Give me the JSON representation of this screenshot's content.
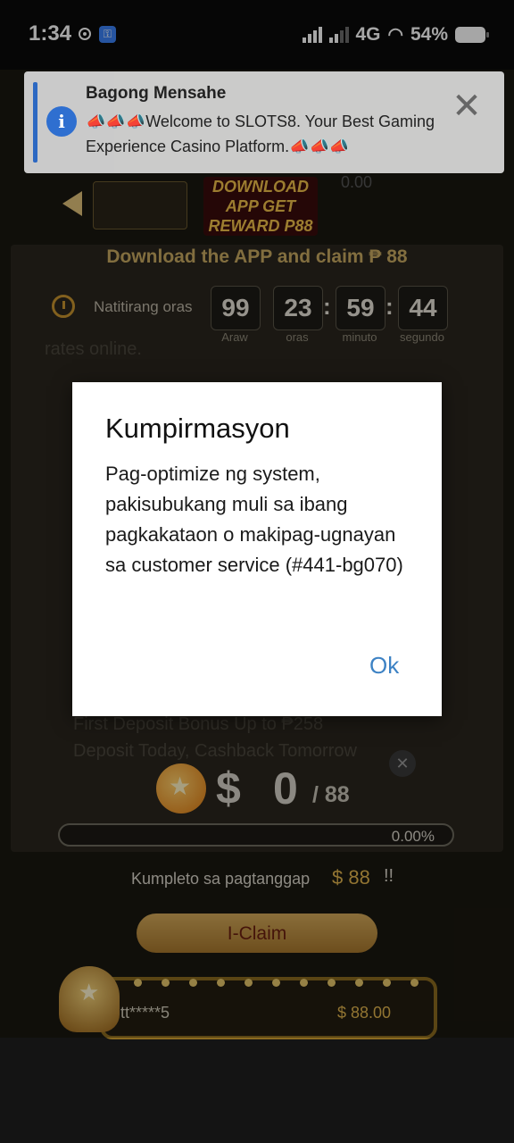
{
  "status_bar": {
    "time": "1:34",
    "network": "4G",
    "battery": "54%"
  },
  "notification": {
    "title": "Bagong Mensahe",
    "body": "📣📣📣Welcome to SLOTS8. Your Best Gaming Experience Casino Platform.📣📣📣",
    "accent_color": "#2f6fd0"
  },
  "background": {
    "download_badge": "DOWNLOAD APP GET REWARD P88",
    "balance": "0.00",
    "panel_title": "Download the APP and claim ₱ 88",
    "timer_label": "Natitirang oras",
    "timer": [
      {
        "value": "99",
        "unit": "Araw"
      },
      {
        "value": "23",
        "unit": "oras"
      },
      {
        "value": "59",
        "unit": "minuto"
      },
      {
        "value": "44",
        "unit": "segundo"
      }
    ],
    "bg_line_1": "rates online.",
    "bg_line_2": "First Deposit Bonus Up to ₱258",
    "bg_line_3": "Deposit Today, Cashback Tomorrow",
    "currency_symbol": "$",
    "current_amount": "0",
    "goal_amount": "/ 88",
    "progress_text": "0.00%",
    "progress_value": 0,
    "complete_label": "Kumpleto sa pagtanggap",
    "complete_amount": "$ 88",
    "complete_suffix": "!!",
    "claim_button": "I-Claim",
    "ticker_user": "tt*****5",
    "ticker_amount": "$ 88.00"
  },
  "dialog": {
    "title": "Kumpirmasyon",
    "message": "Pag-optimize ng system, pakisubukang muli sa ibang pagkakataon o makipag-ugnayan sa customer service (#441-bg070)",
    "ok_label": "Ok",
    "ok_color": "#3d82c4"
  }
}
